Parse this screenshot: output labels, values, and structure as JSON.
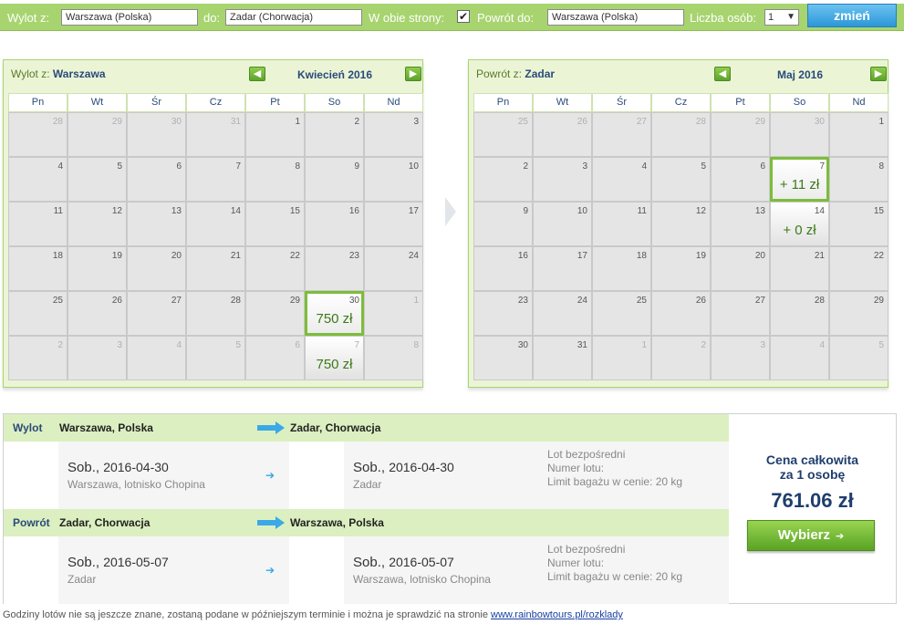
{
  "search": {
    "from_label": "Wylot z:",
    "from_value": "Warszawa (Polska)",
    "to_label": "do:",
    "to_value": "Zadar (Chorwacja)",
    "roundtrip_label": "W obie strony:",
    "roundtrip_checked": "✔",
    "return_label": "Powrót do:",
    "return_value": "Warszawa (Polska)",
    "persons_label": "Liczba osób:",
    "persons_value": "1",
    "change_button": "zmień"
  },
  "weekdays": [
    "Pn",
    "Wt",
    "Śr",
    "Cz",
    "Pt",
    "So",
    "Nd"
  ],
  "outbound_calendar": {
    "title_prefix": "Wylot z:",
    "title_city": "Warszawa",
    "month": "Kwiecień 2016",
    "days": [
      {
        "d": "28",
        "dim": true
      },
      {
        "d": "29",
        "dim": true
      },
      {
        "d": "30",
        "dim": true
      },
      {
        "d": "31",
        "dim": true
      },
      {
        "d": "1"
      },
      {
        "d": "2"
      },
      {
        "d": "3"
      },
      {
        "d": "4"
      },
      {
        "d": "5"
      },
      {
        "d": "6"
      },
      {
        "d": "7"
      },
      {
        "d": "8"
      },
      {
        "d": "9"
      },
      {
        "d": "10"
      },
      {
        "d": "11"
      },
      {
        "d": "12"
      },
      {
        "d": "13"
      },
      {
        "d": "14"
      },
      {
        "d": "15"
      },
      {
        "d": "16"
      },
      {
        "d": "17"
      },
      {
        "d": "18"
      },
      {
        "d": "19"
      },
      {
        "d": "20"
      },
      {
        "d": "21"
      },
      {
        "d": "22"
      },
      {
        "d": "23"
      },
      {
        "d": "24"
      },
      {
        "d": "25"
      },
      {
        "d": "26"
      },
      {
        "d": "27"
      },
      {
        "d": "28"
      },
      {
        "d": "29"
      },
      {
        "d": "30",
        "price": "750 zł",
        "selected": true
      },
      {
        "d": "1",
        "dim": true
      },
      {
        "d": "2",
        "dim": true
      },
      {
        "d": "3",
        "dim": true
      },
      {
        "d": "4",
        "dim": true
      },
      {
        "d": "5",
        "dim": true
      },
      {
        "d": "6",
        "dim": true
      },
      {
        "d": "7",
        "dim": true,
        "price": "750 zł"
      },
      {
        "d": "8",
        "dim": true
      }
    ]
  },
  "return_calendar": {
    "title_prefix": "Powrót z:",
    "title_city": "Zadar",
    "month": "Maj 2016",
    "days": [
      {
        "d": "25",
        "dim": true
      },
      {
        "d": "26",
        "dim": true
      },
      {
        "d": "27",
        "dim": true
      },
      {
        "d": "28",
        "dim": true
      },
      {
        "d": "29",
        "dim": true
      },
      {
        "d": "30",
        "dim": true
      },
      {
        "d": "1"
      },
      {
        "d": "2"
      },
      {
        "d": "3"
      },
      {
        "d": "4"
      },
      {
        "d": "5"
      },
      {
        "d": "6"
      },
      {
        "d": "7",
        "price": "+ 11 zł",
        "selected": true
      },
      {
        "d": "8"
      },
      {
        "d": "9"
      },
      {
        "d": "10"
      },
      {
        "d": "11"
      },
      {
        "d": "12"
      },
      {
        "d": "13"
      },
      {
        "d": "14",
        "price": "+ 0 zł"
      },
      {
        "d": "15"
      },
      {
        "d": "16"
      },
      {
        "d": "17"
      },
      {
        "d": "18"
      },
      {
        "d": "19"
      },
      {
        "d": "20"
      },
      {
        "d": "21"
      },
      {
        "d": "22"
      },
      {
        "d": "23"
      },
      {
        "d": "24"
      },
      {
        "d": "25"
      },
      {
        "d": "26"
      },
      {
        "d": "27"
      },
      {
        "d": "28"
      },
      {
        "d": "29"
      },
      {
        "d": "30"
      },
      {
        "d": "31"
      },
      {
        "d": "1",
        "dim": true
      },
      {
        "d": "2",
        "dim": true
      },
      {
        "d": "3",
        "dim": true
      },
      {
        "d": "4",
        "dim": true
      },
      {
        "d": "5",
        "dim": true
      }
    ]
  },
  "summary": {
    "outbound": {
      "label": "Wylot",
      "from": "Warszawa, Polska",
      "to": "Zadar, Chorwacja",
      "dep_day": "Sob.,",
      "dep_date": "2016-04-30",
      "dep_place": "Warszawa, lotnisko Chopina",
      "arr_day": "Sob.,",
      "arr_date": "2016-04-30",
      "arr_place": "Zadar",
      "info1": "Lot bezpośredni",
      "info2": "Numer lotu:",
      "info3": "Limit bagażu w cenie: 20 kg"
    },
    "return": {
      "label": "Powrót",
      "from": "Zadar, Chorwacja",
      "to": "Warszawa, Polska",
      "dep_day": "Sob.,",
      "dep_date": "2016-05-07",
      "dep_place": "Zadar",
      "arr_day": "Sob.,",
      "arr_date": "2016-05-07",
      "arr_place": "Warszawa, lotnisko Chopina",
      "info1": "Lot bezpośredni",
      "info2": "Numer lotu:",
      "info3": "Limit bagażu w cenie: 20 kg"
    },
    "price_title_line1": "Cena całkowita",
    "price_title_line2": "za 1 osobę",
    "total": "761.06 zł",
    "select_button": "Wybierz"
  },
  "footer": {
    "text": "Godziny lotów nie są jeszcze znane, zostaną podane w późniejszym terminie i można je sprawdzić na stronie ",
    "link": "www.rainbowtours.pl/rozklady"
  },
  "colors": {
    "accent_green": "#a8d46f",
    "price_green": "#3c7a18",
    "navy": "#1f3e6e",
    "button_blue": "#2b97d8"
  }
}
